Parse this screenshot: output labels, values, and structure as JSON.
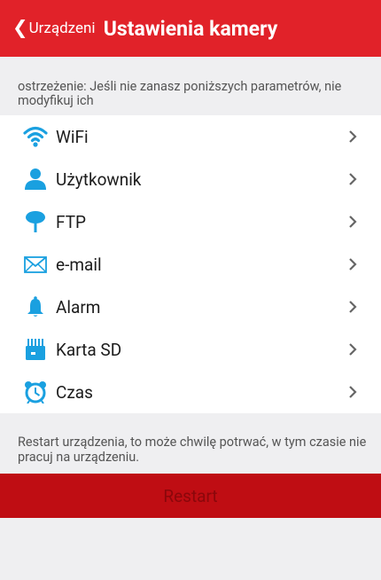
{
  "header": {
    "back_label": "Urządzeni",
    "title": "Ustawienia kamery"
  },
  "warning": "ostrzeżenie: Jeśli nie zanasz poniższych parametrów, nie modyfikuj ich",
  "menu": {
    "items": [
      {
        "label": "WiFi",
        "icon": "wifi-icon"
      },
      {
        "label": "Użytkownik",
        "icon": "user-icon"
      },
      {
        "label": "FTP",
        "icon": "ftp-icon"
      },
      {
        "label": "e-mail",
        "icon": "mail-icon"
      },
      {
        "label": "Alarm",
        "icon": "bell-icon"
      },
      {
        "label": "Karta SD",
        "icon": "sd-card-icon"
      },
      {
        "label": "Czas",
        "icon": "alarm-clock-icon"
      }
    ]
  },
  "restart": {
    "note": "Restart urządzenia, to może chwilę potrwać, w tym czasie nie pracuj na urządzeniu.",
    "button_label": "Restart"
  },
  "colors": {
    "header": "#e12229",
    "accent_blue": "#1aa0e0",
    "restart_bg": "#bf0d13",
    "background": "#efeff1"
  }
}
